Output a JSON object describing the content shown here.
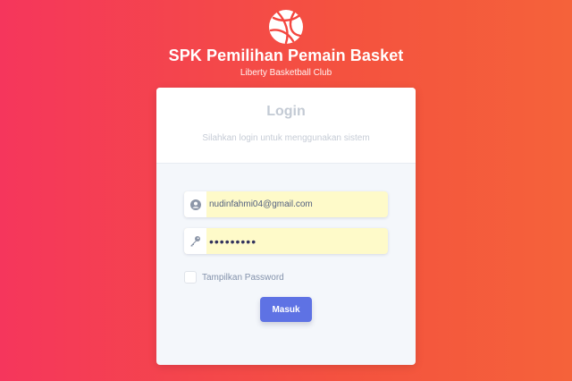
{
  "header": {
    "logo_icon": "basketball-icon",
    "title": "SPK Pemilihan Pemain Basket",
    "subtitle": "Liberty Basketball Club"
  },
  "login": {
    "title": "Login",
    "description": "Silahkan login untuk menggunakan sistem",
    "email": {
      "value": "nudinfahmi04@gmail.com",
      "icon": "user-circle-icon"
    },
    "password": {
      "value": "123456789",
      "icon": "key-icon"
    },
    "show_password_label": "Tampilkan Password",
    "show_password_checked": false,
    "submit_label": "Masuk"
  },
  "colors": {
    "bg_start": "#f5365c",
    "bg_end": "#f5623a",
    "button": "#5e72e4",
    "autofill": "#fefac9"
  }
}
